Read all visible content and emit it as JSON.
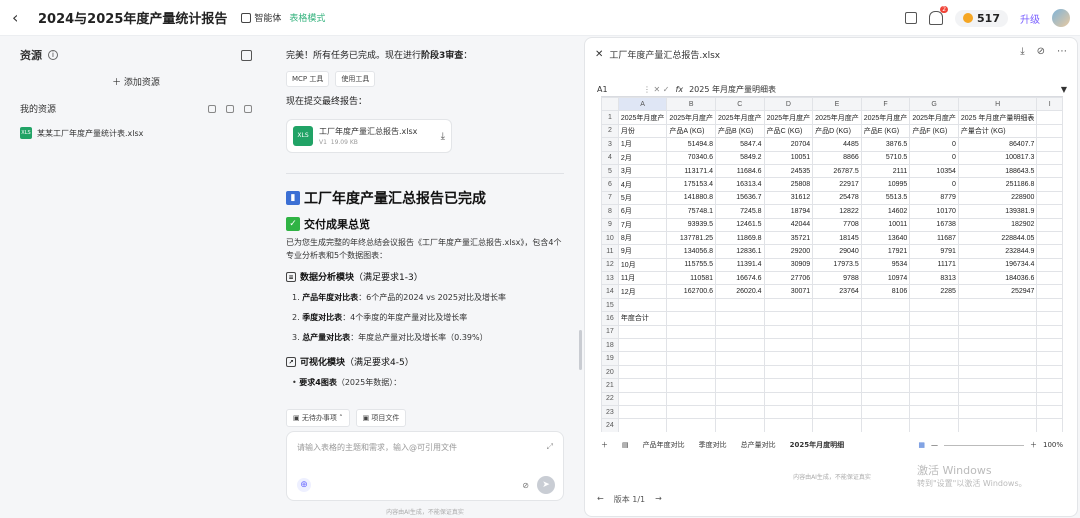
{
  "header": {
    "back": "‹",
    "title": "2024与2025年度产量统计报告",
    "agent_label": "智能体",
    "mode_label": "表格模式",
    "notifications": "2",
    "points": "517",
    "upgrade": "升级"
  },
  "sidebar": {
    "title": "资源",
    "add_resource": "＋ 添加资源",
    "my_resources": "我的资源",
    "files": [
      {
        "name": "某某工厂年度产量统计表.xlsx"
      }
    ]
  },
  "chat": {
    "msg1_prefix": "完美！所有任务已完成。现在进行",
    "msg1_bold": "阶段3审查",
    "msg1_suffix": "：",
    "chip_mcp": "MCP 工具",
    "chip_tool": "使用工具",
    "msg2": "现在提交最终报告：",
    "file_card": {
      "name": "工厂年度产量汇总报告.xlsx",
      "version": "V1",
      "size": "19.09 KB",
      "icon": "XLS"
    },
    "h1": "工厂年度产量汇总报告已完成",
    "h2": "交付成果总览",
    "para1": "已为您生成完整的年终总结会议报告《工厂年度产量汇总报告.xlsx》，包含4个专业分析表和5个数据图表：",
    "section1_title": "数据分析模块",
    "section1_sub": "（满足要求1-3）",
    "items": [
      {
        "num": "1.",
        "bold": "产品年度对比表",
        "text": "：6个产品的2024 vs 2025对比及增长率"
      },
      {
        "num": "2.",
        "bold": "季度对比表",
        "text": "：4个季度的年度产量对比及增长率"
      },
      {
        "num": "3.",
        "bold": "总产量对比表",
        "text": "：年度总产量对比及增长率（0.39%）"
      }
    ],
    "section2_title": "可视化模块",
    "section2_sub": "（满足要求4-5）",
    "item4_bold": "要求4图表",
    "item4_text": "（2025年数据）：",
    "sugg1": "无待办事项",
    "sugg2": "项目文件",
    "input_placeholder": "请输入表格的主题和需求，输入@可引用文件",
    "disclaimer": "内容由AI生成，不能保证真实"
  },
  "panel": {
    "title": "工厂年度产量汇总报告.xlsx",
    "cell_ref": "A1",
    "fx": "fx",
    "formula_value": "2025 年月度产量明细表",
    "col_headers": [
      "A",
      "B",
      "C",
      "D",
      "E",
      "F",
      "G",
      "H",
      "I"
    ],
    "rows": [
      [
        "2025年月度产",
        "2025年月度产",
        "2025年月度产",
        "2025年月度产",
        "2025年月度产",
        "2025年月度产",
        "2025年月度产",
        "2025 年月度产量明细表",
        ""
      ],
      [
        "月份",
        "产品A (KG)",
        "产品B (KG)",
        "产品C (KG)",
        "产品D (KG)",
        "产品E (KG)",
        "产品F (KG)",
        "产量合计 (KG)",
        ""
      ],
      [
        "1月",
        "51494.8",
        "5847.4",
        "20704",
        "4485",
        "3876.5",
        "0",
        "86407.7",
        ""
      ],
      [
        "2月",
        "70340.6",
        "5849.2",
        "10051",
        "8866",
        "5710.5",
        "0",
        "100817.3",
        ""
      ],
      [
        "3月",
        "113171.4",
        "11684.6",
        "24535",
        "26787.5",
        "2111",
        "10354",
        "188643.5",
        ""
      ],
      [
        "4月",
        "175153.4",
        "16313.4",
        "25808",
        "22917",
        "10995",
        "0",
        "251186.8",
        ""
      ],
      [
        "5月",
        "141880.8",
        "15636.7",
        "31612",
        "25478",
        "5513.5",
        "8779",
        "228900",
        ""
      ],
      [
        "6月",
        "75748.1",
        "7245.8",
        "18794",
        "12822",
        "14602",
        "10170",
        "139381.9",
        ""
      ],
      [
        "7月",
        "93939.5",
        "12461.5",
        "42044",
        "7708",
        "10011",
        "16738",
        "182902",
        ""
      ],
      [
        "8月",
        "137781.25",
        "11869.8",
        "35721",
        "18145",
        "13640",
        "11687",
        "228844.05",
        ""
      ],
      [
        "9月",
        "134056.8",
        "12836.1",
        "29200",
        "29040",
        "17921",
        "9791",
        "232844.9",
        ""
      ],
      [
        "10月",
        "115755.5",
        "11391.4",
        "30909",
        "17973.5",
        "9534",
        "11171",
        "196734.4",
        ""
      ],
      [
        "11月",
        "110581",
        "16674.6",
        "27706",
        "9788",
        "10974",
        "8313",
        "184036.6",
        ""
      ],
      [
        "12月",
        "162700.6",
        "26020.4",
        "30071",
        "23764",
        "8106",
        "2285",
        "252947",
        ""
      ],
      [
        "",
        "",
        "",
        "",
        "",
        "",
        "",
        "",
        ""
      ],
      [
        "年度合计",
        "",
        "",
        "",
        "",
        "",
        "",
        "",
        ""
      ],
      [
        "",
        "",
        "",
        "",
        "",
        "",
        "",
        "",
        ""
      ],
      [
        "",
        "",
        "",
        "",
        "",
        "",
        "",
        "",
        ""
      ],
      [
        "",
        "",
        "",
        "",
        "",
        "",
        "",
        "",
        ""
      ],
      [
        "",
        "",
        "",
        "",
        "",
        "",
        "",
        "",
        ""
      ],
      [
        "",
        "",
        "",
        "",
        "",
        "",
        "",
        "",
        ""
      ],
      [
        "",
        "",
        "",
        "",
        "",
        "",
        "",
        "",
        ""
      ],
      [
        "",
        "",
        "",
        "",
        "",
        "",
        "",
        "",
        ""
      ],
      [
        "",
        "",
        "",
        "",
        "",
        "",
        "",
        "",
        ""
      ]
    ],
    "sheet_tabs": [
      "产品年度对比",
      "季度对比",
      "总产量对比",
      "2025年月度明细"
    ],
    "active_tab": 3,
    "zoom": "100%",
    "disclaimer": "内容由AI生成，不能保证真实",
    "version": "版本 1/1",
    "watermark1": "激活 Windows",
    "watermark2": "转到\"设置\"以激活 Windows。"
  }
}
